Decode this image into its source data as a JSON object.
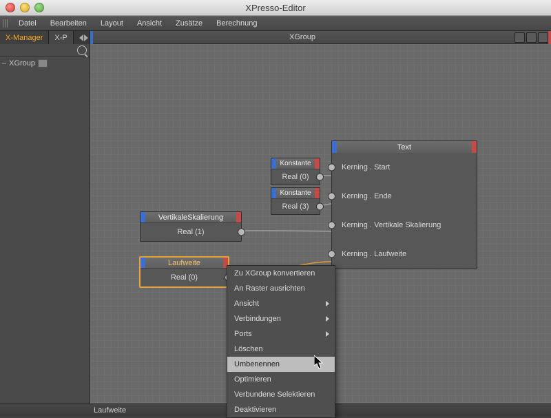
{
  "window": {
    "title": "XPresso-Editor"
  },
  "menu": {
    "items": [
      "Datei",
      "Bearbeiten",
      "Layout",
      "Ansicht",
      "Zusätze",
      "Berechnung"
    ]
  },
  "tabs": {
    "active": "X-Manager",
    "inactive": "X-P"
  },
  "panel": {
    "title": "XGroup"
  },
  "tree": {
    "root": "XGroup"
  },
  "nodes": {
    "vert": {
      "title": "VertikaleSkalierung",
      "row": "Real (1)"
    },
    "lauf": {
      "title": "Laufweite",
      "row": "Real (0)"
    },
    "k1": {
      "title": "Konstante",
      "row": "Real (0)"
    },
    "k2": {
      "title": "Konstante",
      "row": "Real (3)"
    },
    "text": {
      "title": "Text",
      "rows": [
        "Kerning . Start",
        "Kerning . Ende",
        "Kerning . Vertikale Skalierung",
        "Kerning . Laufweite"
      ]
    }
  },
  "context": {
    "items": [
      {
        "label": "Zu XGroup konvertieren",
        "sub": false
      },
      {
        "label": "An Raster ausrichten",
        "sub": false
      },
      {
        "label": "Ansicht",
        "sub": true
      },
      {
        "label": "Verbindungen",
        "sub": true
      },
      {
        "label": "Ports",
        "sub": true
      },
      {
        "label": "Löschen",
        "sub": false
      },
      {
        "label": "Umbenennen",
        "sub": false,
        "hover": true
      },
      {
        "label": "Optimieren",
        "sub": false
      },
      {
        "label": "Verbundene Selektieren",
        "sub": false
      },
      {
        "label": "Deaktivieren",
        "sub": false
      }
    ]
  },
  "status": {
    "text": "Laufweite"
  }
}
